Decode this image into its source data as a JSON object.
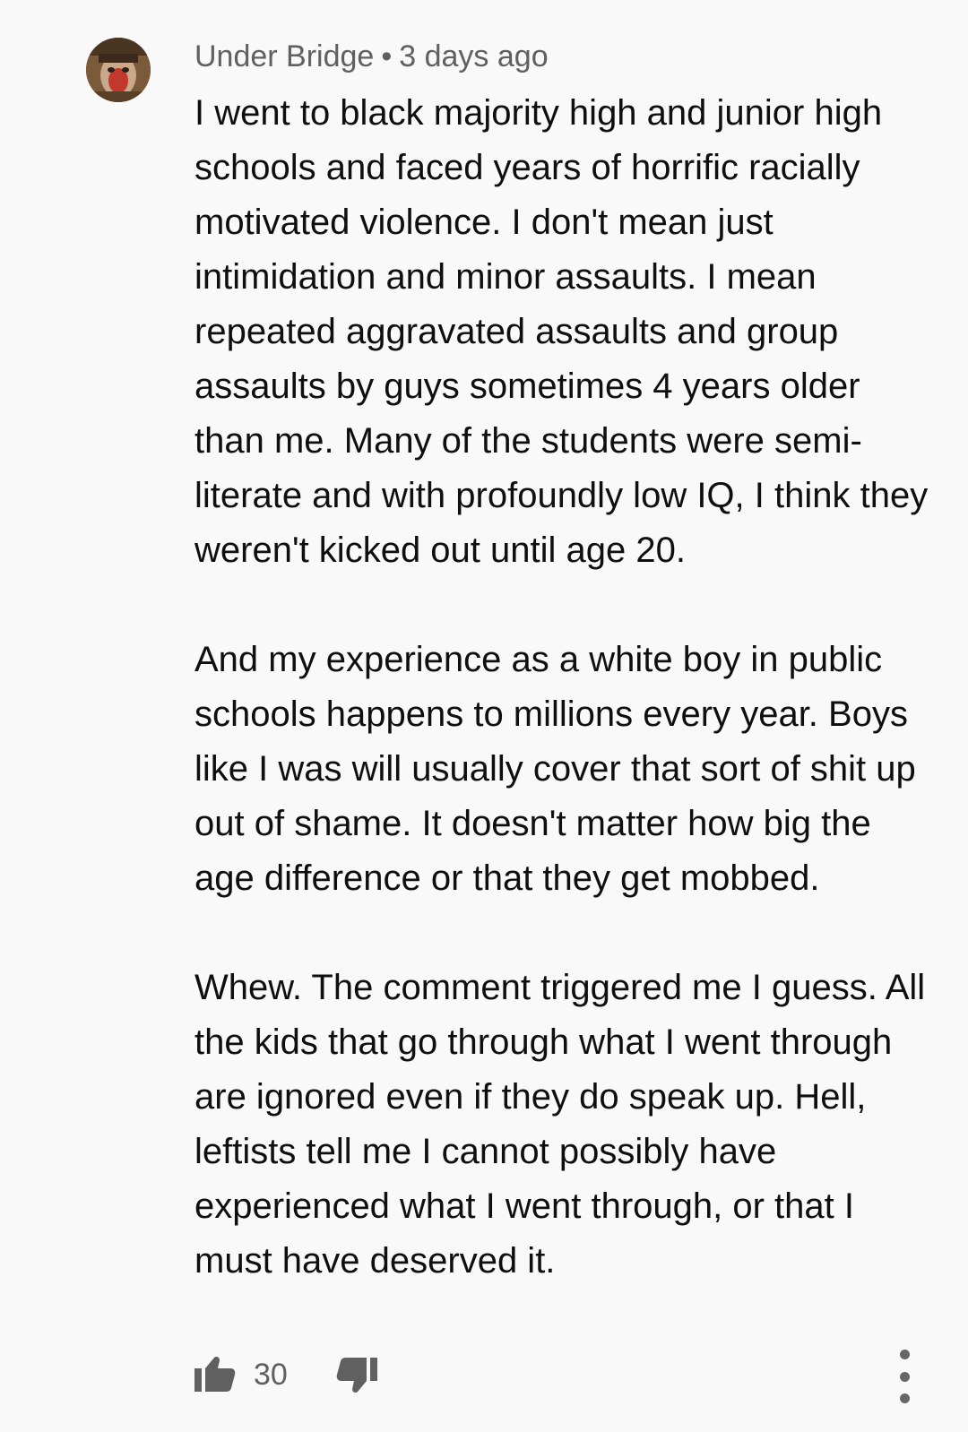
{
  "comment": {
    "author": "Under Bridge",
    "separator": "•",
    "time": "3 days ago",
    "paragraphs": [
      "I went to black majority high and junior high schools and faced years of horrific racially motivated violence. I don't mean just intimidation and minor assaults. I mean repeated aggravated assaults and group assaults by guys sometimes 4 years older than me. Many of the students were semi-literate and with profoundly low IQ, I think they weren't kicked out until age 20.",
      "And my experience as a white boy in public schools happens to millions every year. Boys like I was will usually cover that sort of shit up out of shame. It doesn't matter how big the age difference or that they get mobbed.",
      "Whew. The comment triggered me I guess. All the kids that go through what I went through are ignored even if they do speak up. Hell, leftists tell me I cannot possibly have experienced what I went through, or that I must have deserved it."
    ],
    "like_count": "30",
    "icons": {
      "avatar": "user-avatar",
      "like": "thumbs-up-icon",
      "dislike": "thumbs-down-icon",
      "more": "more-vertical-icon"
    }
  },
  "colors": {
    "background": "#f9f9f9",
    "text": "#0f0f0f",
    "secondary": "#606060",
    "icon": "#606060"
  }
}
